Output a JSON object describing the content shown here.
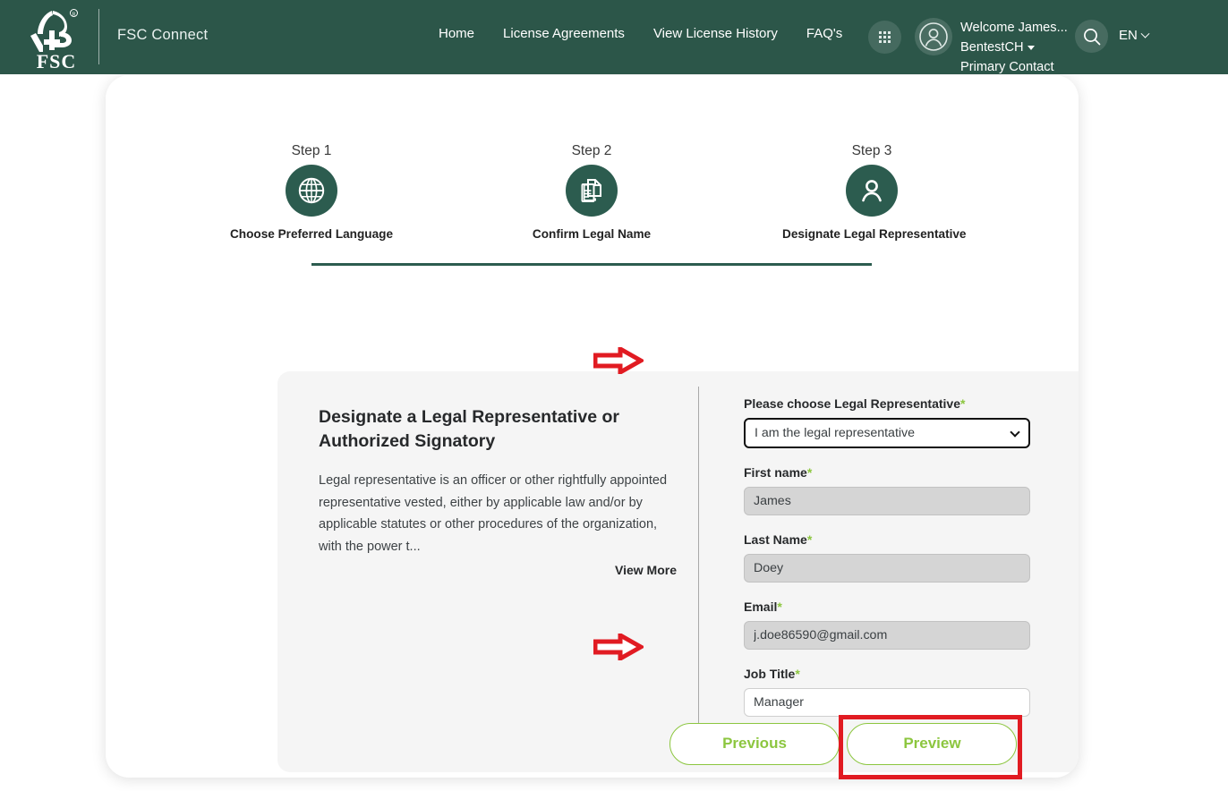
{
  "header": {
    "logo_alt": "FSC",
    "brand": "FSC Connect",
    "nav": [
      {
        "label": "Home"
      },
      {
        "label": "License Agreements"
      },
      {
        "label": "View License History"
      },
      {
        "label": "FAQ's"
      }
    ],
    "apps_icon": "grid-apps-icon",
    "avatar_icon": "user-avatar-icon",
    "search_icon": "search-icon",
    "user": {
      "line1": "Welcome James...",
      "line2": "BentestCH",
      "line3": "Primary Contact"
    },
    "language": "EN",
    "colors": {
      "bar": "#2c5649",
      "text": "#ffffff"
    }
  },
  "stepper": {
    "steps": [
      {
        "num": "Step 1",
        "label": "Choose Preferred Language",
        "icon": "globe-icon"
      },
      {
        "num": "Step 2",
        "label": "Confirm Legal Name",
        "icon": "documents-icon"
      },
      {
        "num": "Step 3",
        "label": "Designate Legal Representative",
        "icon": "person-icon"
      }
    ],
    "accent": "#2c5c4f"
  },
  "panel": {
    "left": {
      "title": "Designate a Legal Representative or Authorized Signatory",
      "body": "Legal representative is an officer or other rightfully appointed representative vested, either by applicable law and/or by applicable statutes or other procedures of the organization, with the power t...",
      "view_more": "View More"
    },
    "right": {
      "fields": [
        {
          "label": "Please choose Legal Representative",
          "required": "*",
          "type": "select",
          "value": "I am the legal representative",
          "state": "highlighted"
        },
        {
          "label": "First name",
          "required": "*",
          "type": "text",
          "value": "James",
          "state": "readonly"
        },
        {
          "label": "Last Name",
          "required": "*",
          "type": "text",
          "value": "Doey",
          "state": "readonly"
        },
        {
          "label": "Email",
          "required": "*",
          "type": "text",
          "value": "j.doe86590@gmail.com",
          "state": "readonly"
        },
        {
          "label": "Job Title",
          "required": "*",
          "type": "text",
          "value": "Manager",
          "state": "editable"
        }
      ]
    }
  },
  "footer": {
    "previous_label": "Previous",
    "preview_label": "Preview",
    "button_color": "#8cc63f"
  },
  "annotations": {
    "arrow_color": "#e11b22",
    "highlight_color": "#e11b22",
    "arrow_1_target": "legal-representative-select",
    "arrow_2_target": "job-title-input",
    "highlight_target": "preview-button"
  }
}
